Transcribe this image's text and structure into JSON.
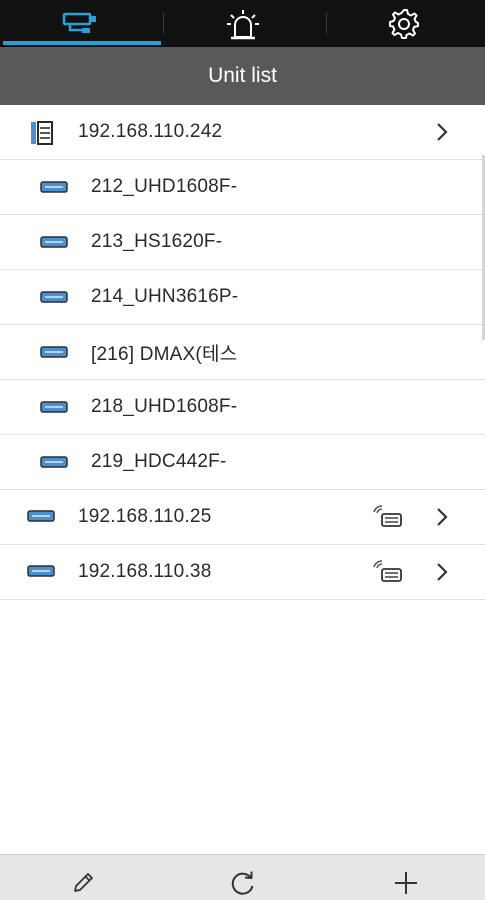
{
  "top_tabs": [
    {
      "name": "units",
      "icon": "cctv-camera-icon",
      "active": true
    },
    {
      "name": "events",
      "icon": "alarm-light-icon",
      "active": false
    },
    {
      "name": "settings",
      "icon": "gear-icon",
      "active": false
    }
  ],
  "header": {
    "title": "Unit list"
  },
  "units": [
    {
      "label": "192.168.110.242",
      "icon": "server-icon",
      "type": "host",
      "has_chevron": true,
      "has_connection_icon": false
    },
    {
      "label": "212_UHD1608F-",
      "icon": "dvr-icon",
      "type": "child"
    },
    {
      "label": "213_HS1620F-",
      "icon": "dvr-icon",
      "type": "child"
    },
    {
      "label": "214_UHN3616P-",
      "icon": "dvr-icon",
      "type": "child"
    },
    {
      "label": "[216] DMAX(테스",
      "icon": "dvr-icon",
      "type": "child"
    },
    {
      "label": "218_UHD1608F-",
      "icon": "dvr-icon",
      "type": "child"
    },
    {
      "label": "219_HDC442F-",
      "icon": "dvr-icon",
      "type": "child"
    },
    {
      "label": "192.168.110.25",
      "icon": "dvr-icon",
      "type": "host",
      "has_chevron": true,
      "has_connection_icon": true
    },
    {
      "label": "192.168.110.38",
      "icon": "dvr-icon",
      "type": "host",
      "has_chevron": true,
      "has_connection_icon": true
    }
  ],
  "bottom_actions": [
    {
      "name": "edit",
      "icon": "pencil-icon"
    },
    {
      "name": "refresh",
      "icon": "refresh-icon"
    },
    {
      "name": "add",
      "icon": "plus-icon"
    }
  ],
  "colors": {
    "top_bar": "#111111",
    "active_tab_indicator": "#2a9fd8",
    "title_bar": "#595959",
    "device_icon": "#4a8fd0",
    "bottom_bar": "#e6e6e6"
  }
}
